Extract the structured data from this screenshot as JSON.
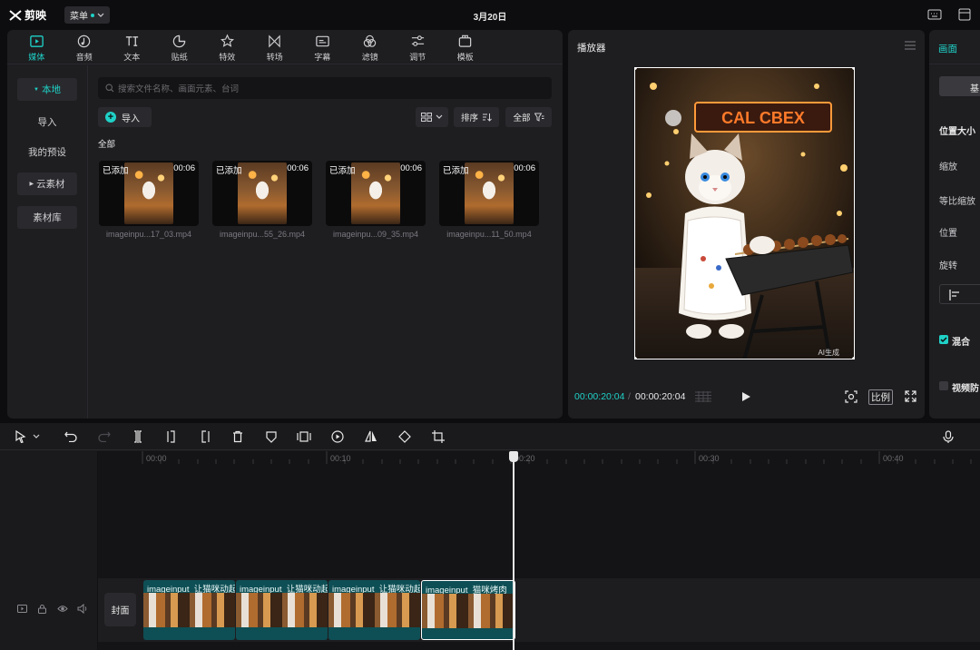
{
  "app": {
    "logo": "剪映",
    "menu_label": "菜单",
    "project_title": "3月20日"
  },
  "media_tabs": [
    {
      "label": "媒体",
      "icon": "media-icon",
      "active": true
    },
    {
      "label": "音频",
      "icon": "audio-icon"
    },
    {
      "label": "文本",
      "icon": "text-icon"
    },
    {
      "label": "贴纸",
      "icon": "sticker-icon"
    },
    {
      "label": "特效",
      "icon": "effects-icon"
    },
    {
      "label": "转场",
      "icon": "transition-icon"
    },
    {
      "label": "字幕",
      "icon": "subtitle-icon"
    },
    {
      "label": "滤镜",
      "icon": "filter-icon"
    },
    {
      "label": "调节",
      "icon": "adjust-icon"
    },
    {
      "label": "模板",
      "icon": "template-icon"
    }
  ],
  "side_nav": [
    {
      "label": "本地",
      "active": true
    },
    {
      "label": "导入"
    },
    {
      "label": "我的预设"
    },
    {
      "label": "云素材"
    },
    {
      "label": "素材库"
    }
  ],
  "search": {
    "placeholder": "搜索文件名称、画面元素、台词"
  },
  "media_tools": {
    "import_label": "导入",
    "sort_label": "排序",
    "filter_label": "全部"
  },
  "section_label": "全部",
  "media_items": [
    {
      "tag": "已添加",
      "duration": "00:06",
      "filename": "imageinpu...17_03.mp4"
    },
    {
      "tag": "已添加",
      "duration": "00:06",
      "filename": "imageinpu...55_26.mp4"
    },
    {
      "tag": "已添加",
      "duration": "00:06",
      "filename": "imageinpu...09_35.mp4"
    },
    {
      "tag": "已添加",
      "duration": "00:06",
      "filename": "imageinpu...11_50.mp4"
    }
  ],
  "player": {
    "title": "播放器",
    "current_time": "00:00:20:04",
    "separator": "/",
    "total_time": "00:00:20:04",
    "ratio_label": "比例",
    "sign_text": "CAL CBEX",
    "watermark": "AI生成"
  },
  "properties": {
    "tab_label": "画面",
    "basic_label": "基",
    "labels": [
      "位置大小",
      "缩放",
      "等比缩放",
      "位置",
      "旋转",
      "混合",
      "视频防"
    ]
  },
  "timeline": {
    "ticks": [
      "00:00",
      "00:10",
      "00:20",
      "00:30",
      "00:40"
    ],
    "cover_label": "封面",
    "clips": [
      {
        "title": "imageinput_让猫咪动起"
      },
      {
        "title": "imageinput_让猫咪动起"
      },
      {
        "title": "imageinput_让猫咪动起"
      },
      {
        "title": "imageinput_猫咪烤肉"
      }
    ]
  },
  "colors": {
    "accent": "#1fd1c7",
    "clip": "#0e4f55",
    "panel": "#1e1e21"
  }
}
